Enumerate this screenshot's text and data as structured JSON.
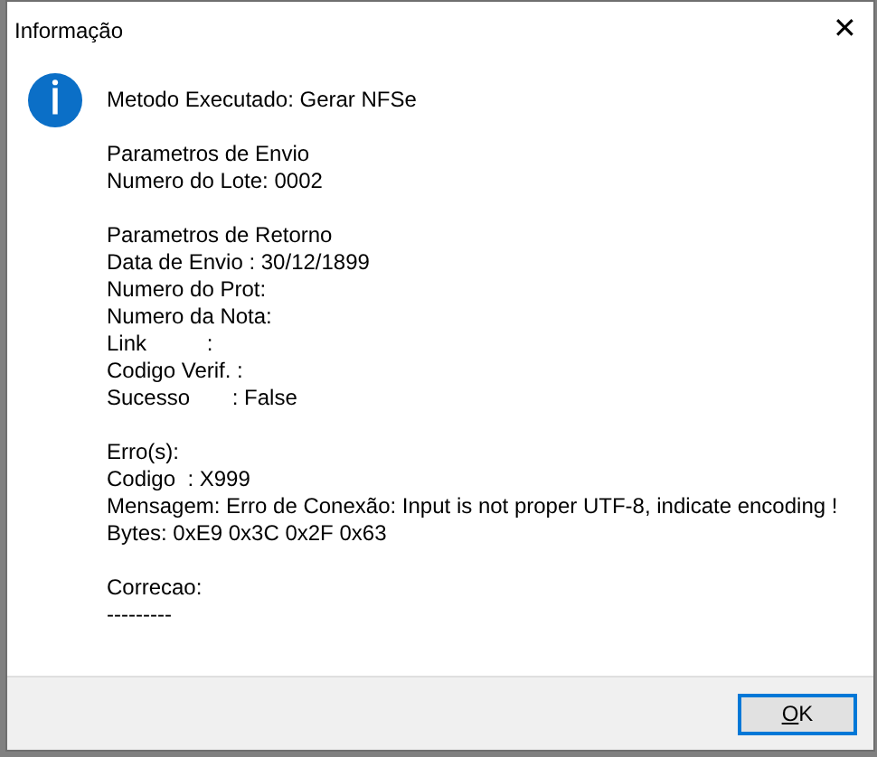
{
  "window": {
    "title": "Informação",
    "close": "✕"
  },
  "message": [
    [
      "Metodo Executado: Gerar NFSe"
    ],
    [
      "Parametros de Envio",
      "Numero do Lote: 0002"
    ],
    [
      "Parametros de Retorno",
      "Data de Envio : 30/12/1899",
      "Numero do Prot:",
      "Numero da Nota:",
      "Link          :",
      "Codigo Verif. :",
      "Sucesso       : False"
    ],
    [
      "Erro(s):",
      "Codigo  : X999",
      "Mensagem: Erro de Conexão: Input is not proper UTF-8, indicate encoding !",
      "Bytes: 0xE9 0x3C 0x2F 0x63"
    ],
    [
      "Correcao:",
      "---------"
    ]
  ],
  "buttons": [
    {
      "label": "OK",
      "focused": true,
      "mnemonic_underlined": true
    }
  ]
}
